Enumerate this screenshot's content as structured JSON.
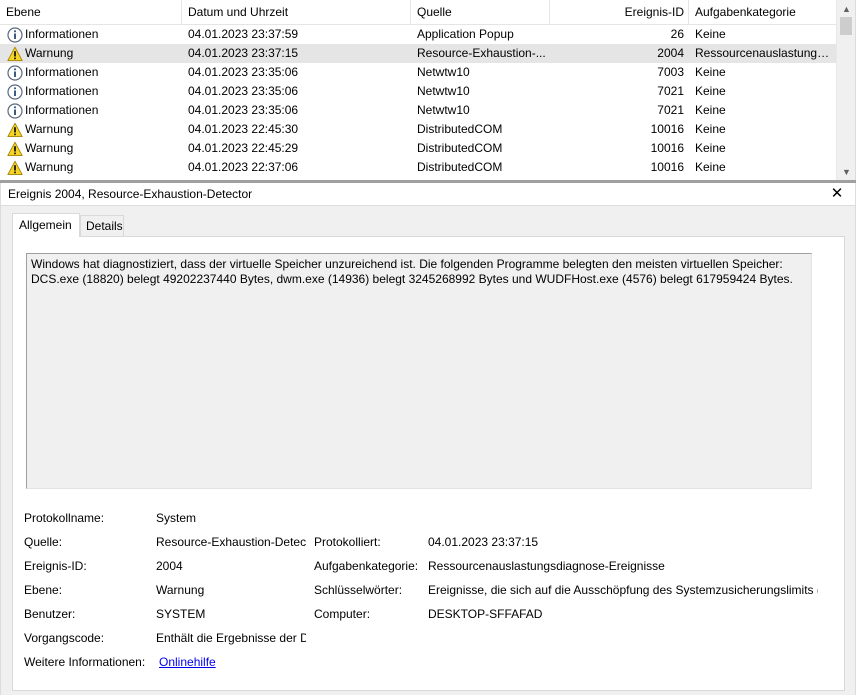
{
  "columns": {
    "ebene": "Ebene",
    "datum": "Datum und Uhrzeit",
    "quelle": "Quelle",
    "id": "Ereignis-ID",
    "kategorie": "Aufgabenkategorie"
  },
  "events": [
    {
      "level": "Informationen",
      "icon": "info-icon",
      "date": "04.01.2023 23:37:59",
      "source": "Application Popup",
      "id": "26",
      "category": "Keine"
    },
    {
      "level": "Warnung",
      "icon": "warning-icon",
      "date": "04.01.2023 23:37:15",
      "source": "Resource-Exhaustion-...",
      "id": "2004",
      "category": "Ressourcenauslastungs..."
    },
    {
      "level": "Informationen",
      "icon": "info-icon",
      "date": "04.01.2023 23:35:06",
      "source": "Netwtw10",
      "id": "7003",
      "category": "Keine"
    },
    {
      "level": "Informationen",
      "icon": "info-icon",
      "date": "04.01.2023 23:35:06",
      "source": "Netwtw10",
      "id": "7021",
      "category": "Keine"
    },
    {
      "level": "Informationen",
      "icon": "info-icon",
      "date": "04.01.2023 23:35:06",
      "source": "Netwtw10",
      "id": "7021",
      "category": "Keine"
    },
    {
      "level": "Warnung",
      "icon": "warning-icon",
      "date": "04.01.2023 22:45:30",
      "source": "DistributedCOM",
      "id": "10016",
      "category": "Keine"
    },
    {
      "level": "Warnung",
      "icon": "warning-icon",
      "date": "04.01.2023 22:45:29",
      "source": "DistributedCOM",
      "id": "10016",
      "category": "Keine"
    },
    {
      "level": "Warnung",
      "icon": "warning-icon",
      "date": "04.01.2023 22:37:06",
      "source": "DistributedCOM",
      "id": "10016",
      "category": "Keine"
    }
  ],
  "detail": {
    "title": "Ereignis 2004, Resource-Exhaustion-Detector",
    "tabs": {
      "general": "Allgemein",
      "details": "Details"
    },
    "message": "Windows hat diagnostiziert, dass der virtuelle Speicher unzureichend ist. Die folgenden Programme belegten den meisten virtuellen Speicher: DCS.exe (18820) belegt 49202237440 Bytes, dwm.exe (14936) belegt 3245268992 Bytes und WUDFHost.exe (4576) belegt 617959424 Bytes.",
    "labels": {
      "protokollname": "Protokollname:",
      "quelle": "Quelle:",
      "ereignis_id": "Ereignis-ID:",
      "ebene": "Ebene:",
      "benutzer": "Benutzer:",
      "vorgangscode": "Vorgangscode:",
      "weitere": "Weitere Informationen:",
      "protokolliert": "Protokolliert:",
      "aufgabenkategorie": "Aufgabenkategorie:",
      "schluesselwoerter": "Schlüsselwörter:",
      "computer": "Computer:"
    },
    "values": {
      "protokollname": "System",
      "quelle": "Resource-Exhaustion-Detect",
      "ereignis_id": "2004",
      "ebene": "Warnung",
      "benutzer": "SYSTEM",
      "vorgangscode": "Enthält die Ergebnisse der Di",
      "weitere": "Onlinehilfe",
      "protokolliert": "04.01.2023 23:37:15",
      "aufgabenkategorie": "Ressourcenauslastungsdiagnose-Ereignisse",
      "schluesselwoerter": "Ereignisse, die sich auf die Ausschöpfung des Systemzusicherungslimits (v",
      "computer": "DESKTOP-SFFAFAD"
    }
  }
}
